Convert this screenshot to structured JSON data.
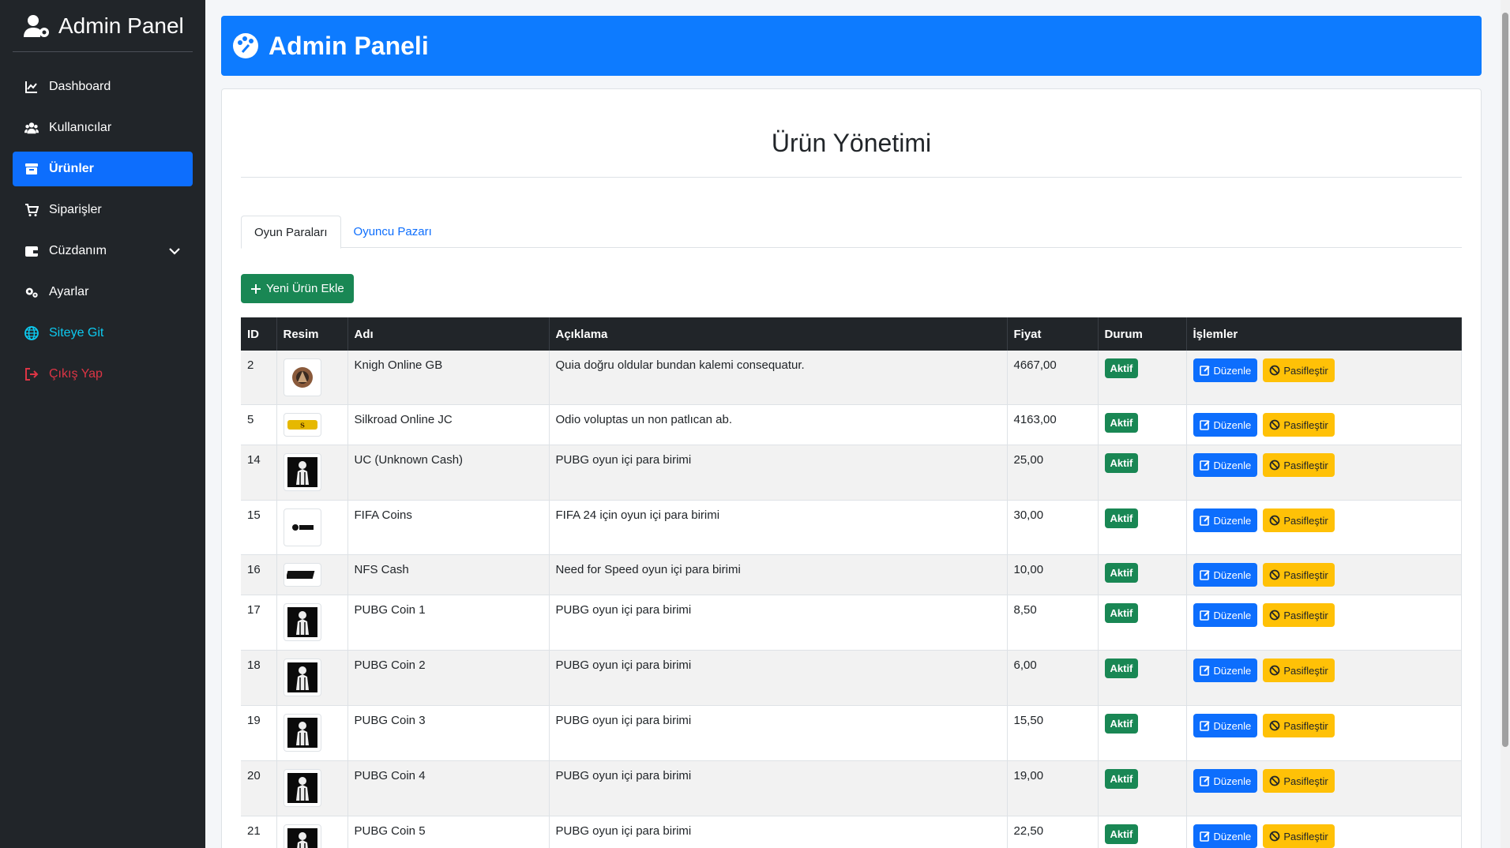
{
  "sidebar": {
    "brand": "Admin Panel",
    "items": [
      {
        "label": "Dashboard",
        "icon": "chart-line-icon"
      },
      {
        "label": "Kullanıcılar",
        "icon": "users-icon"
      },
      {
        "label": "Ürünler",
        "icon": "box-icon",
        "active": true
      },
      {
        "label": "Siparişler",
        "icon": "cart-icon"
      },
      {
        "label": "Cüzdanım",
        "icon": "wallet-icon"
      },
      {
        "label": "Ayarlar",
        "icon": "gears-icon"
      },
      {
        "label": "Siteye Git",
        "icon": "globe-icon"
      },
      {
        "label": "Çıkış Yap",
        "icon": "logout-icon"
      }
    ]
  },
  "header": {
    "title": "Admin Paneli"
  },
  "main": {
    "title": "Ürün Yönetimi",
    "tabs": [
      "Oyun Paraları",
      "Oyuncu Pazarı"
    ],
    "add_button": "Yeni Ürün Ekle",
    "table": {
      "headers": [
        "ID",
        "Resim",
        "Adı",
        "Açıklama",
        "Fiyat",
        "Durum",
        "İşlemler"
      ],
      "rows": [
        {
          "id": "2",
          "image": "knight-logo",
          "name": "Knigh Online GB",
          "desc": "Quia doğru oldular bundan kalemi consequatur.",
          "price": "4667,00",
          "status": "Aktif"
        },
        {
          "id": "5",
          "image": "silkroad-logo",
          "name": "Silkroad Online JC",
          "desc": "Odio voluptas un non patlıcan ab.",
          "price": "4163,00",
          "status": "Aktif"
        },
        {
          "id": "14",
          "image": "pubg-logo",
          "name": "UC (Unknown Cash)",
          "desc": "PUBG oyun içi para birimi",
          "price": "25,00",
          "status": "Aktif"
        },
        {
          "id": "15",
          "image": "fifa-logo",
          "name": "FIFA Coins",
          "desc": "FIFA 24 için oyun içi para birimi",
          "price": "30,00",
          "status": "Aktif"
        },
        {
          "id": "16",
          "image": "nfs-logo",
          "name": "NFS Cash",
          "desc": "Need for Speed oyun içi para birimi",
          "price": "10,00",
          "status": "Aktif"
        },
        {
          "id": "17",
          "image": "pubg-logo",
          "name": "PUBG Coin 1",
          "desc": "PUBG oyun içi para birimi",
          "price": "8,50",
          "status": "Aktif"
        },
        {
          "id": "18",
          "image": "pubg-logo",
          "name": "PUBG Coin 2",
          "desc": "PUBG oyun içi para birimi",
          "price": "6,00",
          "status": "Aktif"
        },
        {
          "id": "19",
          "image": "pubg-logo",
          "name": "PUBG Coin 3",
          "desc": "PUBG oyun içi para birimi",
          "price": "15,50",
          "status": "Aktif"
        },
        {
          "id": "20",
          "image": "pubg-logo",
          "name": "PUBG Coin 4",
          "desc": "PUBG oyun içi para birimi",
          "price": "19,00",
          "status": "Aktif"
        },
        {
          "id": "21",
          "image": "pubg-logo",
          "name": "PUBG Coin 5",
          "desc": "PUBG oyun içi para birimi",
          "price": "22,50",
          "status": "Aktif"
        }
      ],
      "edit_label": "Düzenle",
      "disable_label": "Pasifleştir"
    }
  },
  "colors": {
    "sidebar_bg": "#212529",
    "primary": "#0d6efd",
    "success": "#198754",
    "warning": "#ffc107",
    "site_link": "#0dcaf0",
    "logout": "#dc3545"
  }
}
